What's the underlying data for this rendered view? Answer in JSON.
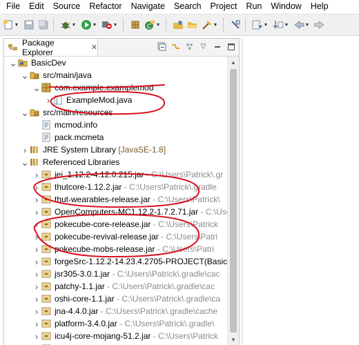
{
  "menubar": {
    "items": [
      "File",
      "Edit",
      "Source",
      "Refactor",
      "Navigate",
      "Search",
      "Project",
      "Run",
      "Window",
      "Help"
    ]
  },
  "toolbar": {
    "icons": [
      "new-icon",
      "save-icon",
      "save-all-icon",
      "debug-icon",
      "run-icon",
      "external-tools-icon",
      "new-java-package-icon",
      "new-class-icon",
      "open-type-icon",
      "open-folder-icon",
      "search-icon",
      "toggle-mark-occurrences-icon",
      "next-annotation-icon",
      "prev-annotation-icon",
      "back-icon",
      "forward-icon"
    ]
  },
  "package_explorer": {
    "tab_label": "Package Explorer",
    "tab_close": "✕",
    "tree": [
      {
        "label": "BasicDev",
        "icon": "project-icon",
        "depth": 0,
        "expanded": true
      },
      {
        "label": "src/main/java",
        "icon": "source-folder-icon",
        "depth": 1,
        "expanded": true
      },
      {
        "label": "com.example.examplemod",
        "icon": "package-icon",
        "depth": 2,
        "expanded": true
      },
      {
        "label": "ExampleMod.java",
        "icon": "java-file-icon",
        "depth": 3,
        "expanded": false
      },
      {
        "label": "src/main/resources",
        "icon": "source-folder-icon",
        "depth": 1,
        "expanded": true
      },
      {
        "label": "mcmod.info",
        "icon": "file-icon",
        "depth": 2
      },
      {
        "label": "pack.mcmeta",
        "icon": "file-icon",
        "depth": 2
      },
      {
        "label": "JRE System Library",
        "decoration": "[JavaSE-1.8]",
        "icon": "library-icon",
        "depth": 1,
        "expanded": false
      },
      {
        "label": "Referenced Libraries",
        "icon": "library-icon",
        "depth": 1,
        "expanded": true
      },
      {
        "label": "jei_1.12.2-4.12.0.215.jar",
        "path": "- C:\\Users\\Patrick\\.gr",
        "icon": "jar-icon",
        "depth": 2,
        "expanded": false
      },
      {
        "label": "thutcore-1.12.2.jar",
        "path": "- C:\\Users\\Patrick\\.gradle",
        "icon": "jar-icon",
        "depth": 2,
        "expanded": false
      },
      {
        "label": "thut-wearables-release.jar",
        "path": "- C:\\Users\\Patrick\\",
        "icon": "jar-icon",
        "depth": 2,
        "expanded": false
      },
      {
        "label": "OpenComputers-MC1.12.2-1.7.2.71.jar",
        "path": "- C:\\Users\\",
        "icon": "jar-icon",
        "depth": 2,
        "expanded": false
      },
      {
        "label": "pokecube-core-release.jar",
        "path": "- C:\\Users\\Patrick",
        "icon": "jar-icon",
        "depth": 2,
        "expanded": false
      },
      {
        "label": "pokecube-revival-release.jar",
        "path": "- C:\\Users\\Patri",
        "icon": "jar-icon",
        "depth": 2,
        "expanded": false
      },
      {
        "label": "pokecube-mobs-release.jar",
        "path": "- C:\\Users\\Patri",
        "icon": "jar-icon",
        "depth": 2,
        "expanded": false
      },
      {
        "label": "forgeSrc-1.12.2-14.23.4.2705-PROJECT(Basic",
        "path": "",
        "icon": "jar-icon",
        "depth": 2,
        "expanded": false
      },
      {
        "label": "jsr305-3.0.1.jar",
        "path": "- C:\\Users\\Patrick\\.gradle\\cac",
        "icon": "jar-icon",
        "depth": 2,
        "expanded": false
      },
      {
        "label": "patchy-1.1.jar",
        "path": "- C:\\Users\\Patrick\\.gradle\\cac",
        "icon": "jar-icon",
        "depth": 2,
        "expanded": false
      },
      {
        "label": "oshi-core-1.1.jar",
        "path": "- C:\\Users\\Patrick\\.gradle\\ca",
        "icon": "jar-icon",
        "depth": 2,
        "expanded": false
      },
      {
        "label": "jna-4.4.0.jar",
        "path": "- C:\\Users\\Patrick\\.gradle\\cache",
        "icon": "jar-icon",
        "depth": 2,
        "expanded": false
      },
      {
        "label": "platform-3.4.0.jar",
        "path": "- C:\\Users\\Patrick\\.gradle\\",
        "icon": "jar-icon",
        "depth": 2,
        "expanded": false
      },
      {
        "label": "icu4j-core-mojang-51.2.jar",
        "path": "- C:\\Users\\Patrick",
        "icon": "jar-icon",
        "depth": 2,
        "expanded": false
      },
      {
        "label": "",
        "path": "",
        "icon": "jar-icon",
        "depth": 2,
        "expanded": false
      }
    ]
  },
  "colors": {
    "annotation": "#d9101e",
    "package_icon": "#b8860b",
    "jar_icon": "#c8a03c",
    "folder_icon": "#d7a93b"
  }
}
